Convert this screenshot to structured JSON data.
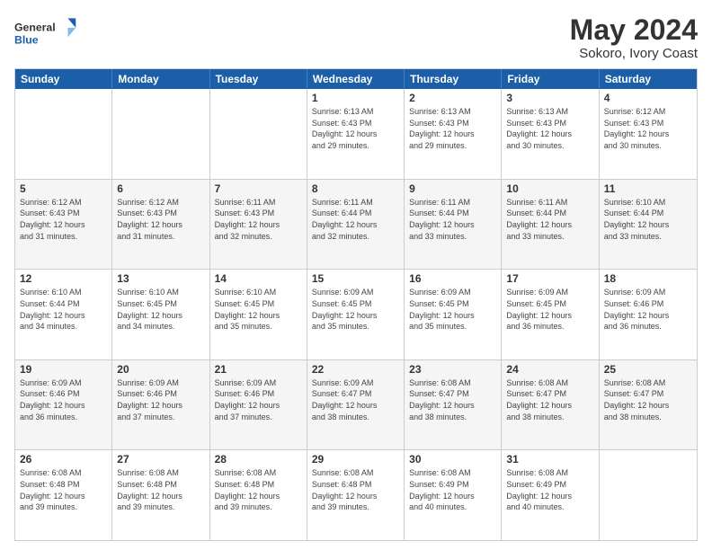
{
  "logo": {
    "line1": "General",
    "line2": "Blue"
  },
  "title": "May 2024",
  "subtitle": "Sokoro, Ivory Coast",
  "header_days": [
    "Sunday",
    "Monday",
    "Tuesday",
    "Wednesday",
    "Thursday",
    "Friday",
    "Saturday"
  ],
  "rows": [
    {
      "alt": false,
      "cells": [
        {
          "num": "",
          "info": ""
        },
        {
          "num": "",
          "info": ""
        },
        {
          "num": "",
          "info": ""
        },
        {
          "num": "1",
          "info": "Sunrise: 6:13 AM\nSunset: 6:43 PM\nDaylight: 12 hours\nand 29 minutes."
        },
        {
          "num": "2",
          "info": "Sunrise: 6:13 AM\nSunset: 6:43 PM\nDaylight: 12 hours\nand 29 minutes."
        },
        {
          "num": "3",
          "info": "Sunrise: 6:13 AM\nSunset: 6:43 PM\nDaylight: 12 hours\nand 30 minutes."
        },
        {
          "num": "4",
          "info": "Sunrise: 6:12 AM\nSunset: 6:43 PM\nDaylight: 12 hours\nand 30 minutes."
        }
      ]
    },
    {
      "alt": true,
      "cells": [
        {
          "num": "5",
          "info": "Sunrise: 6:12 AM\nSunset: 6:43 PM\nDaylight: 12 hours\nand 31 minutes."
        },
        {
          "num": "6",
          "info": "Sunrise: 6:12 AM\nSunset: 6:43 PM\nDaylight: 12 hours\nand 31 minutes."
        },
        {
          "num": "7",
          "info": "Sunrise: 6:11 AM\nSunset: 6:43 PM\nDaylight: 12 hours\nand 32 minutes."
        },
        {
          "num": "8",
          "info": "Sunrise: 6:11 AM\nSunset: 6:44 PM\nDaylight: 12 hours\nand 32 minutes."
        },
        {
          "num": "9",
          "info": "Sunrise: 6:11 AM\nSunset: 6:44 PM\nDaylight: 12 hours\nand 33 minutes."
        },
        {
          "num": "10",
          "info": "Sunrise: 6:11 AM\nSunset: 6:44 PM\nDaylight: 12 hours\nand 33 minutes."
        },
        {
          "num": "11",
          "info": "Sunrise: 6:10 AM\nSunset: 6:44 PM\nDaylight: 12 hours\nand 33 minutes."
        }
      ]
    },
    {
      "alt": false,
      "cells": [
        {
          "num": "12",
          "info": "Sunrise: 6:10 AM\nSunset: 6:44 PM\nDaylight: 12 hours\nand 34 minutes."
        },
        {
          "num": "13",
          "info": "Sunrise: 6:10 AM\nSunset: 6:45 PM\nDaylight: 12 hours\nand 34 minutes."
        },
        {
          "num": "14",
          "info": "Sunrise: 6:10 AM\nSunset: 6:45 PM\nDaylight: 12 hours\nand 35 minutes."
        },
        {
          "num": "15",
          "info": "Sunrise: 6:09 AM\nSunset: 6:45 PM\nDaylight: 12 hours\nand 35 minutes."
        },
        {
          "num": "16",
          "info": "Sunrise: 6:09 AM\nSunset: 6:45 PM\nDaylight: 12 hours\nand 35 minutes."
        },
        {
          "num": "17",
          "info": "Sunrise: 6:09 AM\nSunset: 6:45 PM\nDaylight: 12 hours\nand 36 minutes."
        },
        {
          "num": "18",
          "info": "Sunrise: 6:09 AM\nSunset: 6:46 PM\nDaylight: 12 hours\nand 36 minutes."
        }
      ]
    },
    {
      "alt": true,
      "cells": [
        {
          "num": "19",
          "info": "Sunrise: 6:09 AM\nSunset: 6:46 PM\nDaylight: 12 hours\nand 36 minutes."
        },
        {
          "num": "20",
          "info": "Sunrise: 6:09 AM\nSunset: 6:46 PM\nDaylight: 12 hours\nand 37 minutes."
        },
        {
          "num": "21",
          "info": "Sunrise: 6:09 AM\nSunset: 6:46 PM\nDaylight: 12 hours\nand 37 minutes."
        },
        {
          "num": "22",
          "info": "Sunrise: 6:09 AM\nSunset: 6:47 PM\nDaylight: 12 hours\nand 38 minutes."
        },
        {
          "num": "23",
          "info": "Sunrise: 6:08 AM\nSunset: 6:47 PM\nDaylight: 12 hours\nand 38 minutes."
        },
        {
          "num": "24",
          "info": "Sunrise: 6:08 AM\nSunset: 6:47 PM\nDaylight: 12 hours\nand 38 minutes."
        },
        {
          "num": "25",
          "info": "Sunrise: 6:08 AM\nSunset: 6:47 PM\nDaylight: 12 hours\nand 38 minutes."
        }
      ]
    },
    {
      "alt": false,
      "cells": [
        {
          "num": "26",
          "info": "Sunrise: 6:08 AM\nSunset: 6:48 PM\nDaylight: 12 hours\nand 39 minutes."
        },
        {
          "num": "27",
          "info": "Sunrise: 6:08 AM\nSunset: 6:48 PM\nDaylight: 12 hours\nand 39 minutes."
        },
        {
          "num": "28",
          "info": "Sunrise: 6:08 AM\nSunset: 6:48 PM\nDaylight: 12 hours\nand 39 minutes."
        },
        {
          "num": "29",
          "info": "Sunrise: 6:08 AM\nSunset: 6:48 PM\nDaylight: 12 hours\nand 39 minutes."
        },
        {
          "num": "30",
          "info": "Sunrise: 6:08 AM\nSunset: 6:49 PM\nDaylight: 12 hours\nand 40 minutes."
        },
        {
          "num": "31",
          "info": "Sunrise: 6:08 AM\nSunset: 6:49 PM\nDaylight: 12 hours\nand 40 minutes."
        },
        {
          "num": "",
          "info": ""
        }
      ]
    }
  ]
}
